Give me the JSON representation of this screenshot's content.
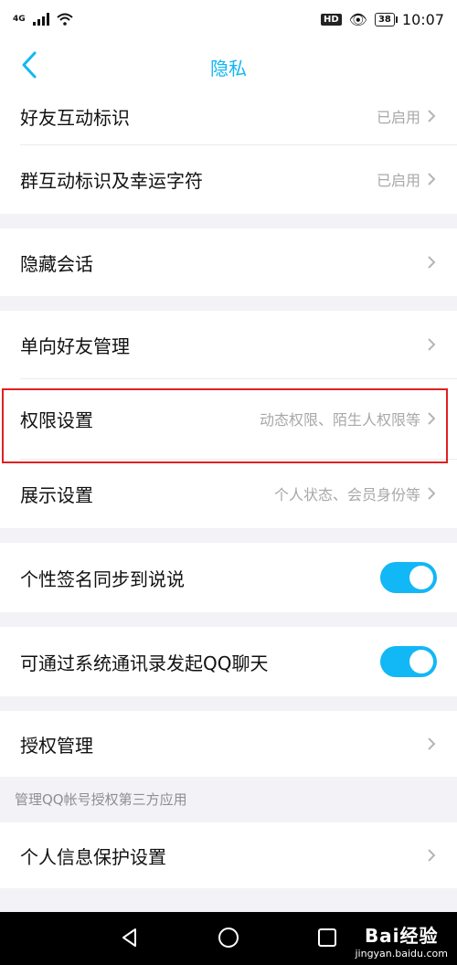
{
  "status_bar": {
    "network": "4G",
    "time": "10:07",
    "hd": "HD",
    "battery": "38"
  },
  "nav": {
    "title": "隐私"
  },
  "groups": {
    "g1": [
      {
        "label": "好友互动标识",
        "value": "已启用"
      },
      {
        "label": "群互动标识及幸运字符",
        "value": "已启用"
      }
    ],
    "hidden_chat": {
      "label": "隐藏会话"
    },
    "oneway_friends": {
      "label": "单向好友管理"
    },
    "perm": {
      "label": "权限设置",
      "value": "动态权限、陌生人权限等"
    },
    "display": {
      "label": "展示设置",
      "value": "个人状态、会员身份等"
    },
    "signature_sync": {
      "label": "个性签名同步到说说",
      "on": true
    },
    "contacts_qq": {
      "label": "可通过系统通讯录发起QQ聊天",
      "on": true
    },
    "auth_mgmt": {
      "label": "授权管理"
    },
    "auth_note": "管理QQ帐号授权第三方应用",
    "personal_info": {
      "label": "个人信息保护设置"
    }
  },
  "watermark": {
    "brand": "Bai经验",
    "url": "jingyan.baidu.com"
  },
  "colors": {
    "accent": "#12b7f5",
    "highlight": "#e02020"
  },
  "icons": [
    "back-icon",
    "chevron-right-icon",
    "nav-back-icon",
    "nav-home-icon",
    "nav-recent-icon"
  ]
}
